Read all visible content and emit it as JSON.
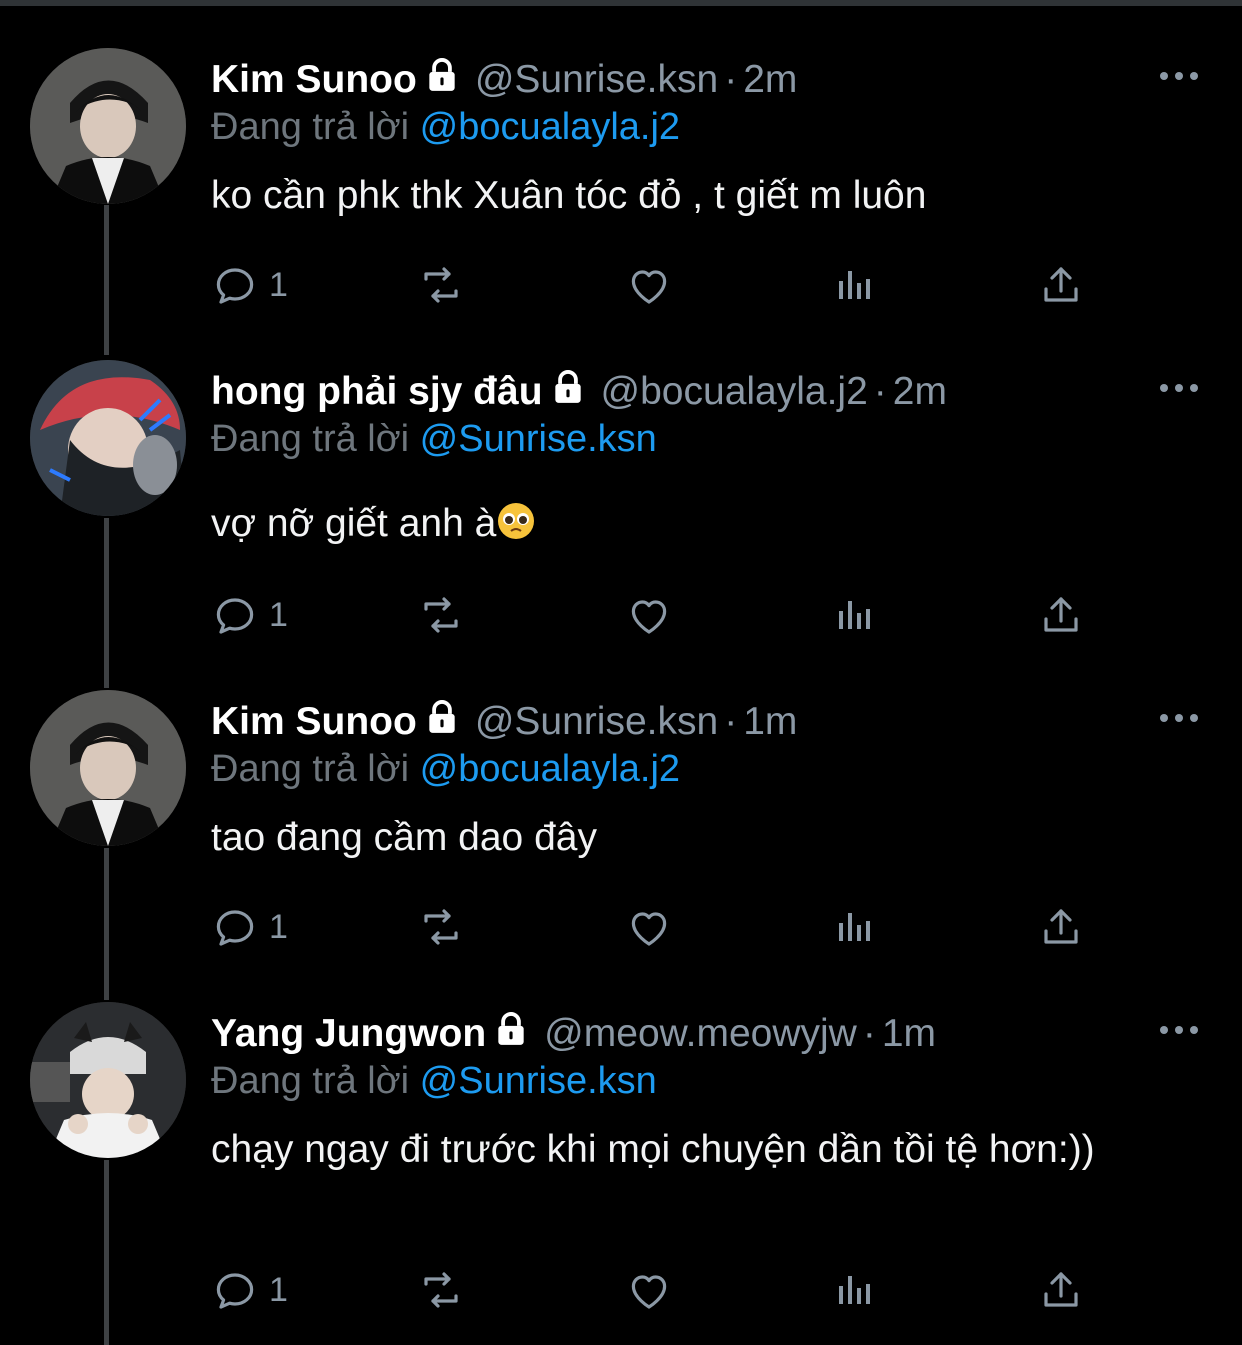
{
  "tweets": [
    {
      "name": "Kim Sunoo",
      "handle": "@Sunrise.ksn",
      "dot": "·",
      "time": "2m",
      "reply_prefix": "Đang trả lời",
      "reply_to": "@bocualayla.j2",
      "text": "ko cần phk thk Xuân tóc đỏ , t giết m luôn",
      "reply_count": "1",
      "avatar_icon": "avatar-photo"
    },
    {
      "name": "hong phải sjy đâu",
      "handle": "@bocualayla.j2",
      "dot": "·",
      "time": "2m",
      "reply_prefix": "Đang trả lời",
      "reply_to": "@Sunrise.ksn",
      "text": "vợ nỡ giết anh à",
      "emoji": "pleading-face-emoji",
      "reply_count": "1",
      "avatar_icon": "avatar-photo"
    },
    {
      "name": "Kim Sunoo",
      "handle": "@Sunrise.ksn",
      "dot": "·",
      "time": "1m",
      "reply_prefix": "Đang trả lời",
      "reply_to": "@bocualayla.j2",
      "text": "tao đang cầm dao đây",
      "reply_count": "1",
      "avatar_icon": "avatar-photo"
    },
    {
      "name": "Yang Jungwon",
      "handle": "@meow.meowyjw",
      "dot": "·",
      "time": "1m",
      "reply_prefix": "Đang trả lời",
      "reply_to": "@Sunrise.ksn",
      "text": "chạy ngay đi trước khi mọi chuyện dần tồi tệ hơn:))",
      "reply_count": "1",
      "avatar_icon": "avatar-photo"
    }
  ],
  "colors": {
    "background": "#000000",
    "mention": "#1d9bf0",
    "muted": "#8b98a5",
    "thread_line": "#3e4144"
  },
  "icons": [
    "reply-icon",
    "retweet-icon",
    "like-icon",
    "views-icon",
    "share-icon",
    "lock-icon",
    "more-icon"
  ]
}
